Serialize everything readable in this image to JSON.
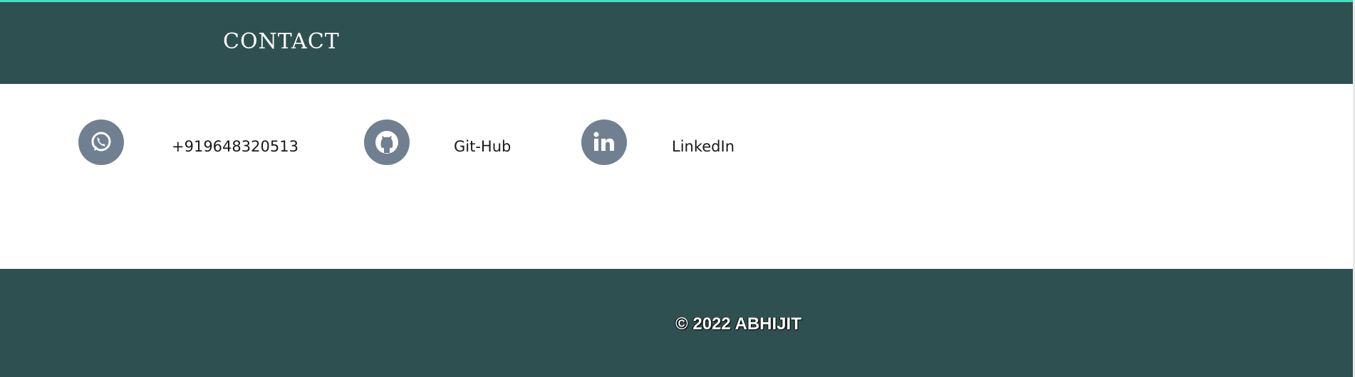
{
  "header": {
    "title": "CONTACT"
  },
  "contacts": [
    {
      "icon": "whatsapp-icon",
      "label": "+919648320513"
    },
    {
      "icon": "github-icon",
      "label": "Git-Hub"
    },
    {
      "icon": "linkedin-icon",
      "label": "LinkedIn"
    }
  ],
  "footer": {
    "text": "© 2022 ABHIJIT"
  },
  "colors": {
    "band": "#2f5050",
    "icon_bg": "#708090",
    "accent_line": "#40e0c0"
  }
}
